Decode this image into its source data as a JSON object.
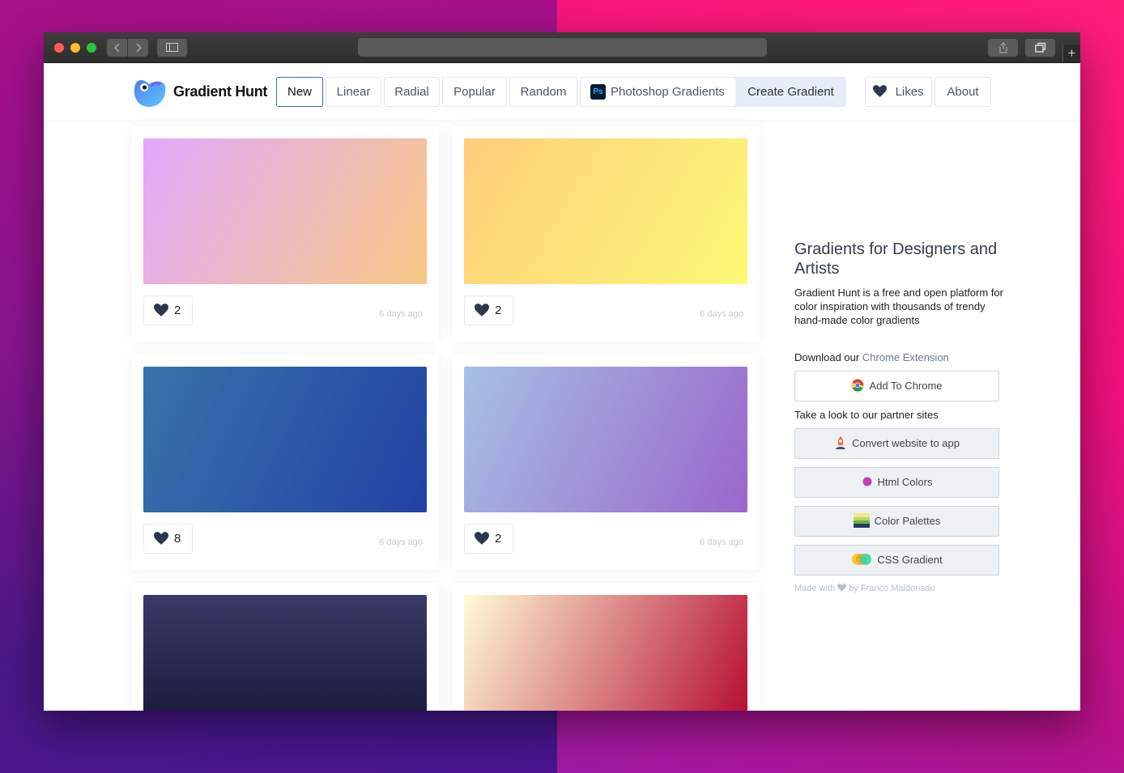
{
  "navbar": {
    "brand": "Gradient Hunt",
    "items": [
      {
        "label": "New",
        "active": true
      },
      {
        "label": "Linear"
      },
      {
        "label": "Radial"
      },
      {
        "label": "Popular"
      },
      {
        "label": "Random"
      },
      {
        "label": "Photoshop Gradients",
        "icon": "photoshop-icon",
        "icon_text": "Ps"
      },
      {
        "label": "Create Gradient"
      },
      {
        "label": "Likes",
        "icon": "heart-icon"
      },
      {
        "label": "About"
      }
    ]
  },
  "cards": [
    {
      "likes": "2",
      "time": "6 days ago",
      "gradient": [
        "#e3a8fe",
        "#f7c985"
      ]
    },
    {
      "likes": "2",
      "time": "6 days ago",
      "gradient": [
        "#fecd7a",
        "#fbf976"
      ]
    },
    {
      "likes": "8",
      "time": "6 days ago",
      "gradient": [
        "#3873aa",
        "#2242a5"
      ]
    },
    {
      "likes": "2",
      "time": "6 days ago",
      "gradient": [
        "#a6c0e4",
        "#9a66cb"
      ]
    },
    {
      "likes": "",
      "time": "",
      "gradient": [
        "#3b3966",
        "#151536"
      ]
    },
    {
      "likes": "",
      "time": "",
      "gradient": [
        "#fffbd6",
        "#b4062c"
      ]
    }
  ],
  "sidebar": {
    "title": "Gradients for Designers and Artists",
    "description": "Gradient Hunt is a free and open platform for color inspiration with thousands of trendy hand-made color gradients",
    "download_prefix": "Download our",
    "download_link": "Chrome Extension",
    "add_to_chrome": "Add To Chrome",
    "partners_label": "Take a look to our partner sites",
    "partners": [
      {
        "label": "Convert website to app",
        "icon": "rocket-icon"
      },
      {
        "label": "Html Colors",
        "icon": "color-dot-icon"
      },
      {
        "label": "Color Palettes",
        "icon": "palette-icon"
      },
      {
        "label": "CSS Gradient",
        "icon": "css-gradient-icon"
      }
    ],
    "credit_prefix": "Made with",
    "credit_suffix": "by Franco Maldonado"
  },
  "colors": {
    "accent": "#2f6bd8",
    "heart": "#2d3748",
    "muted": "#c3cbd6"
  }
}
